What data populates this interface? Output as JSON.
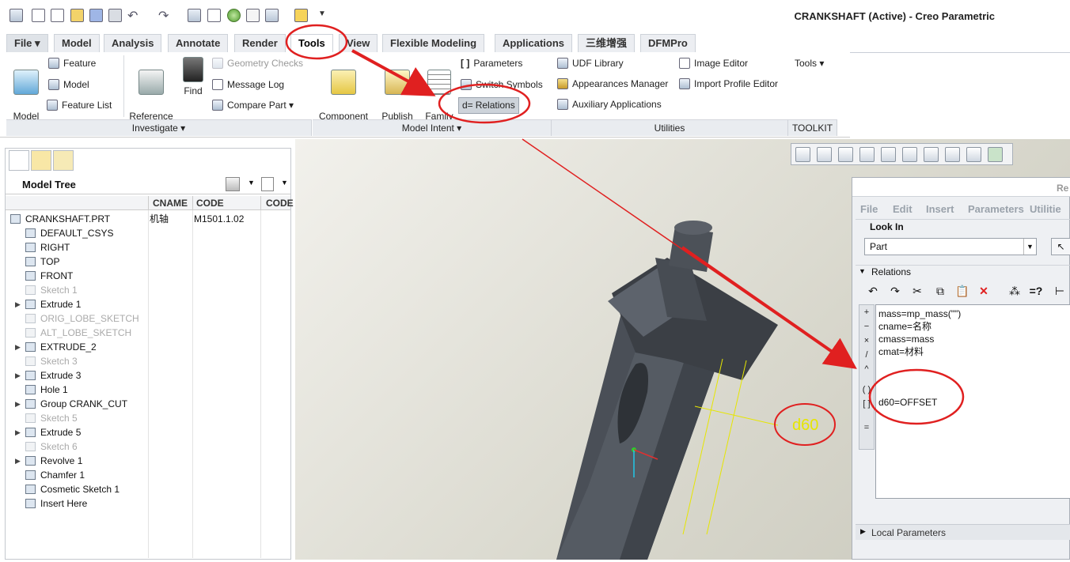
{
  "window": {
    "title": "CRANKSHAFT (Active) - Creo Parametric"
  },
  "tabs": [
    {
      "label": "File ▾"
    },
    {
      "label": "Model"
    },
    {
      "label": "Analysis"
    },
    {
      "label": "Annotate"
    },
    {
      "label": "Render"
    },
    {
      "label": "Tools"
    },
    {
      "label": "View"
    },
    {
      "label": "Flexible Modeling"
    },
    {
      "label": "Applications"
    },
    {
      "label": "三维增强"
    },
    {
      "label": "DFMPro"
    }
  ],
  "ribbon": {
    "investigate": {
      "footer": "Investigate ▾",
      "model_player": "Model\nPlayer",
      "feature": "Feature",
      "model": "Model",
      "feature_list": "Feature List",
      "reference_viewer": "Reference\nViewer",
      "find": "Find",
      "geometry_checks": "Geometry Checks",
      "message_log": "Message Log",
      "compare_part": "Compare Part ▾"
    },
    "model_intent": {
      "footer": "Model Intent ▾",
      "component_interface": "Component\nInterface",
      "publish_geometry": "Publish\nGeometry",
      "family_table": "Family\nTable",
      "parameters": "Parameters",
      "switch_symbols": "Switch Symbols",
      "relations": "Relations",
      "relations_prefix": "d="
    },
    "utilities": {
      "footer": "Utilities",
      "udf_library": "UDF Library",
      "appearances_manager": "Appearances Manager",
      "auxiliary_applications": "Auxiliary Applications",
      "image_editor": "Image Editor",
      "import_profile_editor": "Import Profile Editor"
    },
    "toolkit": {
      "footer": "TOOLKIT",
      "tools": "Tools ▾"
    }
  },
  "model_tree": {
    "title": "Model Tree",
    "columns": [
      "",
      "CNAME",
      "CODE",
      "CODE"
    ],
    "rows": [
      {
        "label": "CRANKSHAFT.PRT",
        "cname": "机轴",
        "code": "M1501.1.02",
        "expand": "",
        "suppressed": false
      },
      {
        "label": "DEFAULT_CSYS",
        "expand": "",
        "suppressed": false
      },
      {
        "label": "RIGHT",
        "expand": "",
        "suppressed": false
      },
      {
        "label": "TOP",
        "expand": "",
        "suppressed": false
      },
      {
        "label": "FRONT",
        "expand": "",
        "suppressed": false
      },
      {
        "label": "Sketch 1",
        "expand": "",
        "suppressed": true
      },
      {
        "label": "Extrude 1",
        "expand": "▶",
        "suppressed": false
      },
      {
        "label": "ORIG_LOBE_SKETCH",
        "expand": "",
        "suppressed": true
      },
      {
        "label": "ALT_LOBE_SKETCH",
        "expand": "",
        "suppressed": true
      },
      {
        "label": "EXTRUDE_2",
        "expand": "▶",
        "suppressed": false
      },
      {
        "label": "Sketch 3",
        "expand": "",
        "suppressed": true
      },
      {
        "label": "Extrude 3",
        "expand": "▶",
        "suppressed": false
      },
      {
        "label": "Hole 1",
        "expand": "",
        "suppressed": false
      },
      {
        "label": "Group CRANK_CUT",
        "expand": "▶",
        "suppressed": false
      },
      {
        "label": "Sketch 5",
        "expand": "",
        "suppressed": true
      },
      {
        "label": "Extrude 5",
        "expand": "▶",
        "suppressed": false
      },
      {
        "label": "Sketch 6",
        "expand": "",
        "suppressed": true
      },
      {
        "label": "Revolve 1",
        "expand": "▶",
        "suppressed": false
      },
      {
        "label": "Chamfer 1",
        "expand": "",
        "suppressed": false
      },
      {
        "label": "Cosmetic Sketch 1",
        "expand": "",
        "suppressed": false
      },
      {
        "label": "Insert Here",
        "expand": "",
        "suppressed": false
      }
    ]
  },
  "viewport": {
    "dimension_label": "d60"
  },
  "relations_dialog": {
    "title": "Re",
    "menu": [
      "File",
      "Edit",
      "Insert",
      "Parameters",
      "Utilitie"
    ],
    "look_in_label": "Look In",
    "look_in_value": "Part",
    "section_relations": "Relations",
    "section_local_parameters": "Local Parameters",
    "sidebar_ops": [
      "+",
      "−",
      "×",
      "/",
      "^",
      "( )",
      "[ ]",
      "="
    ],
    "lines": [
      "mass=mp_mass(\"\")",
      "cname=名称",
      "cmass=mass",
      "cmat=材料",
      "",
      "",
      "",
      "d60=OFFSET"
    ]
  }
}
